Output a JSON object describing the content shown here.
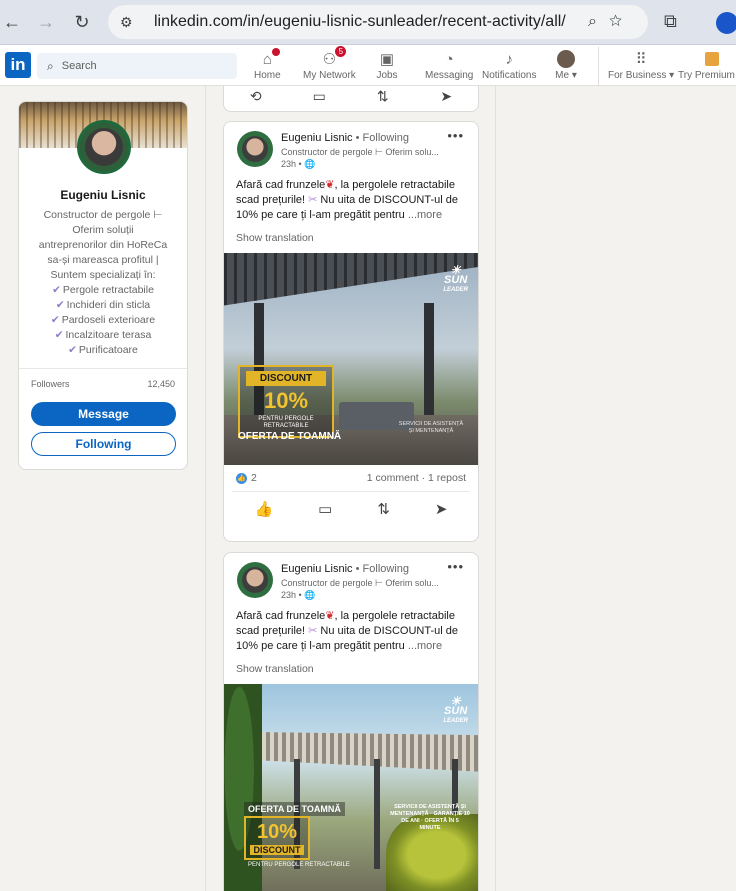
{
  "browser": {
    "back_icon": "arrow-left-icon",
    "forward_icon": "arrow-right-icon",
    "reload_icon": "reload-icon",
    "url": "linkedin.com/in/eugeniu-lisnic-sunleader/recent-activity/all/"
  },
  "nav": {
    "logo": "in",
    "search_placeholder": "Search",
    "items": [
      {
        "label": "Home",
        "icon": "home-icon",
        "badge": ""
      },
      {
        "label": "My Network",
        "icon": "network-icon",
        "badge": "5"
      },
      {
        "label": "Jobs",
        "icon": "briefcase-icon",
        "badge": ""
      },
      {
        "label": "Messaging",
        "icon": "chat-icon",
        "badge": ""
      },
      {
        "label": "Notifications",
        "icon": "bell-icon",
        "badge": ""
      },
      {
        "label": "Me",
        "icon": "avatar-icon",
        "badge": ""
      },
      {
        "label": "For Business",
        "icon": "grid-icon",
        "badge": ""
      },
      {
        "label": "Try Premium fo",
        "icon": "premium-icon",
        "badge": ""
      }
    ]
  },
  "profile": {
    "name": "Eugeniu Lisnic",
    "headline_lines": [
      "Constructor de pergole ⊢",
      "Oferim soluții",
      "antreprenorilor din HoReCa",
      "sa-și mareasca profitul |",
      "Suntem specializați în:"
    ],
    "specialties": [
      "Pergole retractabile",
      "Inchideri din sticla",
      "Pardoseli exterioare",
      "Incalzitoare terasa",
      "Purificatoare"
    ],
    "followers_label": "Followers",
    "followers_count": "12,450",
    "message_label": "Message",
    "following_label": "Following"
  },
  "posts": [
    {
      "author": "Eugeniu Lisnic",
      "follow_state": "• Following",
      "subtitle": "Constructor de pergole ⊢ Oferim solu...",
      "time": "23h •",
      "text_before_leaf": "Afară cad frunzele",
      "text_after_leaf": ", la pergolele retractabile scad prețurile!",
      "text_tail": " Nu uita de DISCOUNT-ul de 10% pe care ți l-am pregătit pentru",
      "more": "...more",
      "translation": "Show translation",
      "image": {
        "discount": "DISCOUNT",
        "percent": "10%",
        "small": "PENTRU PERGOLE RETRACTABILE",
        "offer": "OFERTA DE TOAMNĂ",
        "brand_top": "SUN",
        "brand_bottom": "LEADER",
        "side_note": "SERVICII DE ASISTENȚĂ ȘI MENTENANȚĂ"
      },
      "likes": "2",
      "stats": "1 comment · 1 repost"
    },
    {
      "author": "Eugeniu Lisnic",
      "follow_state": "• Following",
      "subtitle": "Constructor de pergole ⊢ Oferim solu...",
      "time": "23h •",
      "text_before_leaf": "Afară cad frunzele",
      "text_after_leaf": ", la pergolele retractabile scad prețurile!",
      "text_tail": " Nu uita de DISCOUNT-ul de 10% pe care ți l-am pregătit pentru",
      "more": "...more",
      "translation": "Show translation",
      "image": {
        "offer": "OFERTA DE TOAMNĂ",
        "percent": "10%",
        "discount": "DISCOUNT",
        "small": "PENTRU PERGOLE RETRACTABILE",
        "brand_top": "SUN",
        "brand_bottom": "LEADER",
        "service_note": "SERVICII DE ASISTENȚĂ ȘI MENTENANȚĂ · GARANȚIE 10 DE ANI · OFERTĂ ÎN 5 MINUTE"
      }
    }
  ],
  "colors": {
    "linkedin_blue": "#0a66c2",
    "badge_red": "#cb112d",
    "promo_gold": "#e2b427"
  }
}
